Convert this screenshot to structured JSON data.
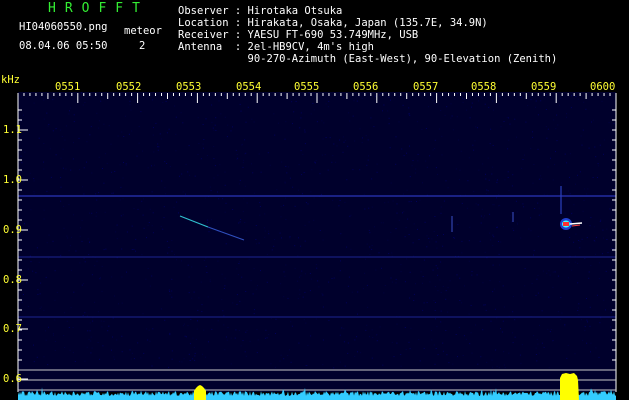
{
  "header": {
    "logo": "HROFFT",
    "filename": "HI04060550.png",
    "datetime": "08.04.06 05:50",
    "meteor_label": "meteor",
    "meteor_count": "2",
    "info_lines": [
      "Observer : Hirotaka Otsuka",
      "Location : Hirakata, Osaka, Japan (135.7E, 34.9N)",
      "Receiver : YAESU FT-690 53.749MHz, USB",
      "Antenna  : 2el-HB9CV, 4m's high",
      "           90-270-Azimuth (East-West), 90-Elevation (Zenith)"
    ]
  },
  "axes": {
    "y_unit": "kHz",
    "y_ticks": [
      "1.1",
      "1.0",
      "0.9",
      "0.8",
      "0.7",
      "0.6"
    ],
    "x_ticks": [
      "0551",
      "0552",
      "0553",
      "0554",
      "0555",
      "0556",
      "0557",
      "0558",
      "0559",
      "0600"
    ]
  },
  "colors": {
    "logo": "#33ee33",
    "tick_labels": "#ffff33",
    "grid_ticks": "#ffffff",
    "carrier_line": "#2a35b8",
    "background_noise": "#00004a",
    "echo_head": "#ff3030",
    "echo_tail": "#40ffff",
    "ref_lines": "#c8c8c8",
    "noise_floor": "#33ccff",
    "meteor_bursts": "#ffff00"
  }
}
